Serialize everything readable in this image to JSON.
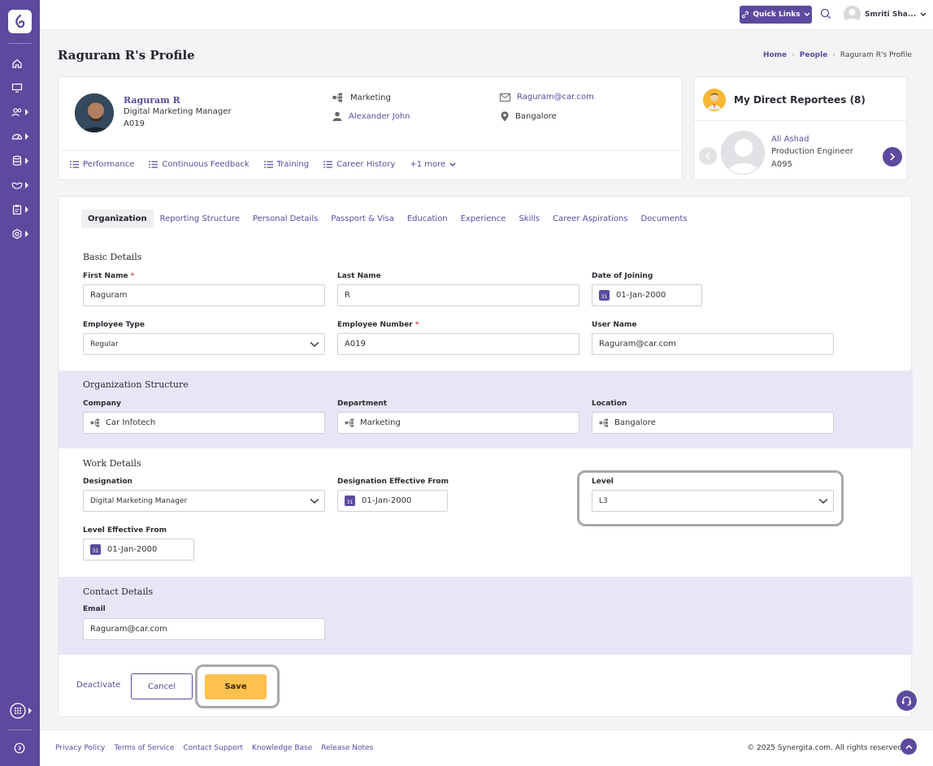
{
  "topbar": {
    "quick_links": "Quick Links",
    "user_name": "Smriti Sha..."
  },
  "page": {
    "title": "Raguram R's Profile",
    "breadcrumb": [
      "Home",
      "People",
      "Raguram R's Profile"
    ]
  },
  "profile": {
    "name": "Raguram R",
    "designation": "Digital Marketing Manager",
    "code": "A019",
    "department": "Marketing",
    "manager": "Alexander John",
    "email": "Raguram@car.com",
    "location": "Bangalore",
    "tabs": [
      "Performance",
      "Continuous Feedback",
      "Training",
      "Career History",
      "+1 more"
    ]
  },
  "reportees": {
    "title": "My Direct Reportees (8)",
    "name": "Ali Ashad",
    "role": "Production Engineer",
    "code": "A095"
  },
  "tabs": [
    "Organization",
    "Reporting Structure",
    "Personal Details",
    "Passport & Visa",
    "Education",
    "Experience",
    "Skills",
    "Career Aspirations",
    "Documents"
  ],
  "basic": {
    "title": "Basic Details",
    "first_name_label": "First Name",
    "first_name": "Raguram",
    "last_name_label": "Last Name",
    "last_name": "R",
    "doj_label": "Date of Joining",
    "doj": "01-Jan-2000",
    "emp_type_label": "Employee Type",
    "emp_type": "Regular",
    "emp_no_label": "Employee Number",
    "emp_no": "A019",
    "username_label": "User Name",
    "username": "Raguram@car.com"
  },
  "org": {
    "title": "Organization Structure",
    "company_label": "Company",
    "company": "Car Infotech",
    "department_label": "Department",
    "department": "Marketing",
    "location_label": "Location",
    "location": "Bangalore"
  },
  "work": {
    "title": "Work Details",
    "designation_label": "Designation",
    "designation": "Digital Marketing Manager",
    "desig_eff_label": "Designation Effective From",
    "desig_eff": "01-Jan-2000",
    "level_label": "Level",
    "level": "L3",
    "level_eff_label": "Level Effective From",
    "level_eff": "01-Jan-2000"
  },
  "contact": {
    "title": "Contact Details",
    "email_label": "Email",
    "email": "Raguram@car.com"
  },
  "actions": {
    "deactivate": "Deactivate",
    "cancel": "Cancel",
    "save": "Save"
  },
  "footer": {
    "links": [
      "Privacy Policy",
      "Terms of Service",
      "Contact Support",
      "Knowledge Base",
      "Release Notes"
    ],
    "copyright": "© 2025 Synergita.com. All rights reserved"
  },
  "colors": {
    "brand": "#5b4a9e",
    "save": "#ffc04d",
    "section_shade": "#e8e6f6"
  }
}
